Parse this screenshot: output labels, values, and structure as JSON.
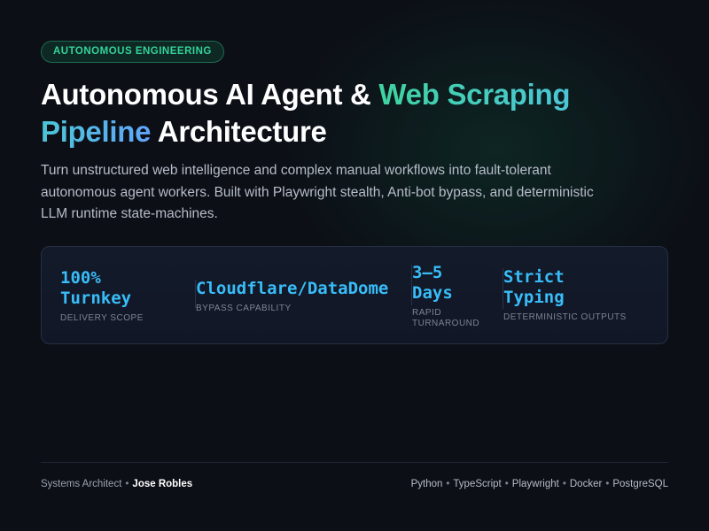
{
  "badge": "AUTONOMOUS ENGINEERING",
  "title": {
    "part1": "Autonomous AI Agent & ",
    "highlight1": "Web Scraping",
    "highlight2": "Pipeline",
    "part2": " Architecture"
  },
  "description": "Turn unstructured web intelligence and complex manual workflows into fault-tolerant autonomous agent workers. Built with Playwright stealth, Anti-bot bypass, and deterministic LLM runtime state-machines.",
  "stats": [
    {
      "value": "100%\nTurnkey",
      "label": "DELIVERY SCOPE"
    },
    {
      "value": "Cloudflare/DataDome",
      "label": "BYPASS CAPABILITY"
    },
    {
      "value": "3–5\nDays",
      "label": "RAPID\nTURNAROUND"
    },
    {
      "value": "Strict\nTyping",
      "label": "DETERMINISTIC OUTPUTS"
    }
  ],
  "footer": {
    "role": "Systems Architect",
    "separator": "•",
    "name": "Jose Robles",
    "tech": [
      "Python",
      "TypeScript",
      "Playwright",
      "Docker",
      "PostgreSQL"
    ]
  },
  "colors": {
    "accent_green": "#34d399",
    "accent_blue": "#38bdf8",
    "background": "#0c0f16"
  }
}
